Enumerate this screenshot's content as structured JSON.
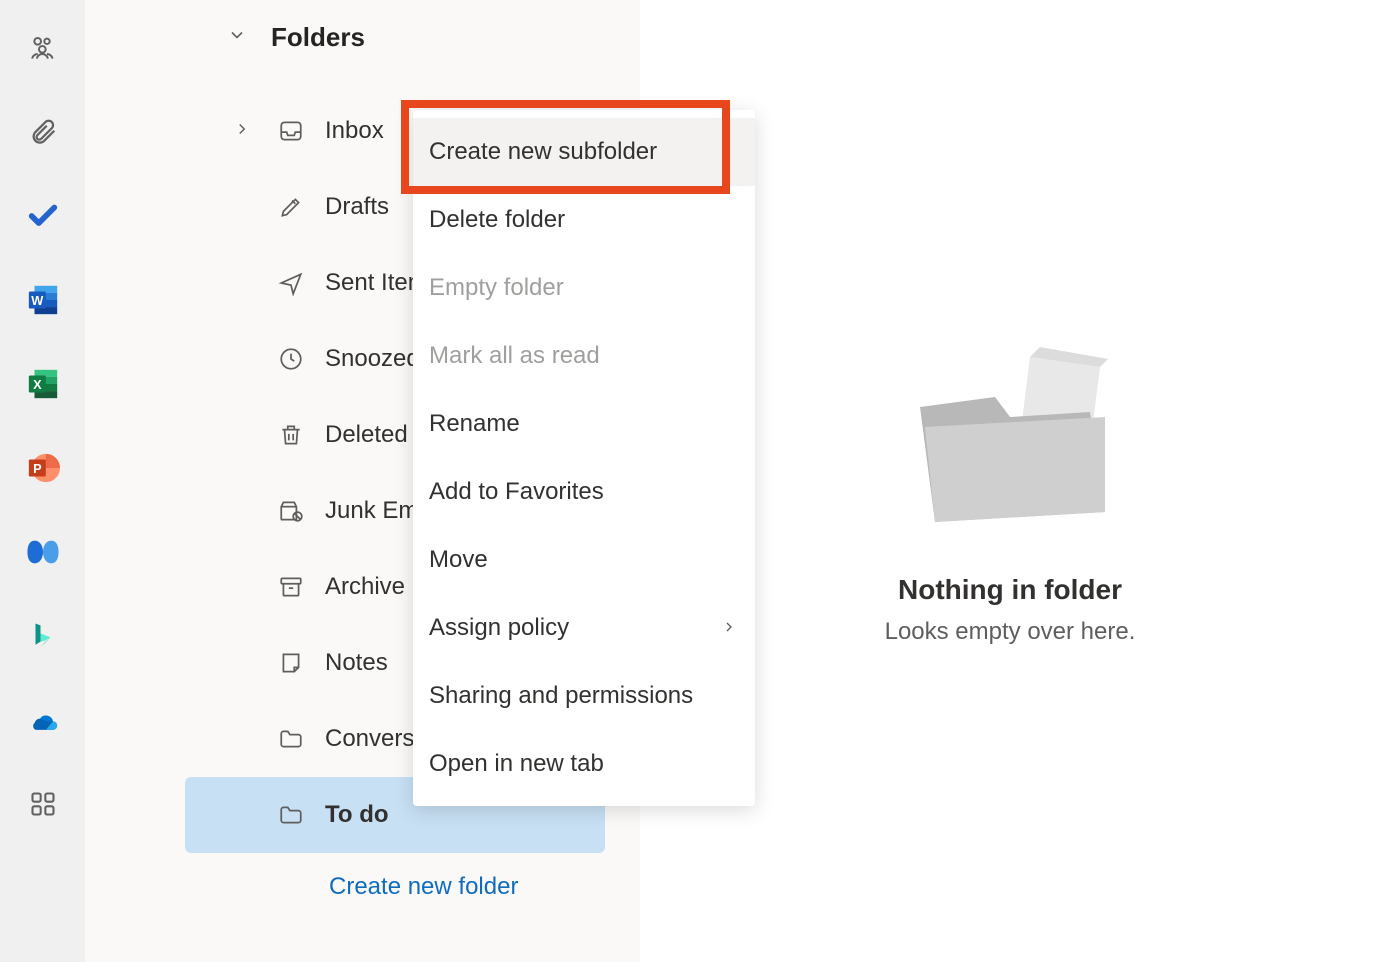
{
  "rail": {
    "items": [
      "people",
      "attach",
      "todo",
      "word",
      "excel",
      "powerpoint",
      "viva",
      "bing",
      "onedrive",
      "apps"
    ]
  },
  "folders": {
    "header": "Folders",
    "items": [
      {
        "label": "Inbox",
        "icon": "inbox",
        "expandable": true
      },
      {
        "label": "Drafts",
        "icon": "drafts"
      },
      {
        "label": "Sent Items",
        "icon": "sent"
      },
      {
        "label": "Snoozed",
        "icon": "snoozed"
      },
      {
        "label": "Deleted Items",
        "icon": "deleted"
      },
      {
        "label": "Junk Email",
        "icon": "junk"
      },
      {
        "label": "Archive",
        "icon": "archive"
      },
      {
        "label": "Notes",
        "icon": "notes"
      },
      {
        "label": "Conversation History",
        "icon": "folder"
      },
      {
        "label": "To do",
        "icon": "folder",
        "selected": true
      }
    ],
    "create_link": "Create new folder"
  },
  "context_menu": {
    "items": [
      {
        "label": "Create new subfolder",
        "hovered": true,
        "highlighted": true
      },
      {
        "label": "Delete folder"
      },
      {
        "label": "Empty folder",
        "disabled": true
      },
      {
        "label": "Mark all as read",
        "disabled": true
      },
      {
        "label": "Rename"
      },
      {
        "label": "Add to Favorites"
      },
      {
        "label": "Move"
      },
      {
        "label": "Assign policy",
        "submenu": true
      },
      {
        "label": "Sharing and permissions"
      },
      {
        "label": "Open in new tab"
      }
    ]
  },
  "empty_state": {
    "title": "Nothing in folder",
    "subtitle": "Looks empty over here."
  }
}
